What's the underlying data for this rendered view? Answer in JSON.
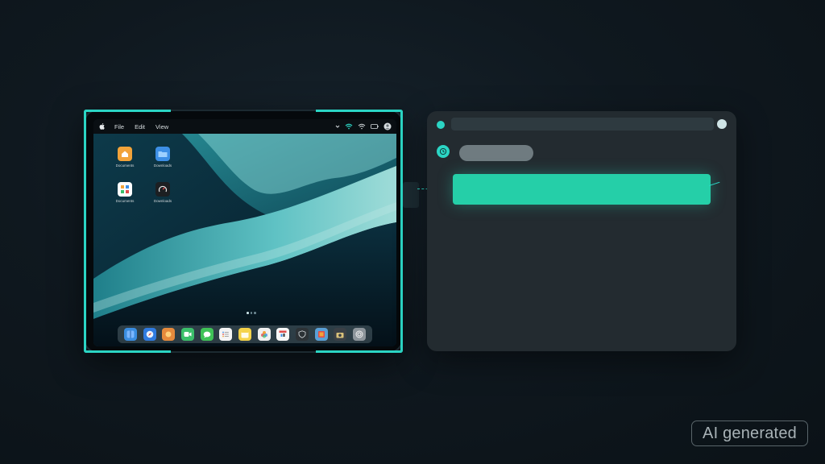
{
  "menubar": {
    "items": [
      "File",
      "Edit",
      "View"
    ]
  },
  "desktop": {
    "icons": [
      {
        "label": "Documents",
        "icon": "home-icon",
        "color": "#f2a33a"
      },
      {
        "label": "Downloads",
        "icon": "folder-icon",
        "color": "#3d8fe6"
      },
      {
        "label": "Documents",
        "icon": "grid-apps-icon",
        "color": "#ffffff"
      },
      {
        "label": "Downloads",
        "icon": "dial-icon",
        "color": "#1c1f22"
      }
    ]
  },
  "dock": {
    "apps": [
      {
        "name": "finder-icon",
        "color": "#3a8de0"
      },
      {
        "name": "safari-icon",
        "color": "#2f7be0"
      },
      {
        "name": "photos-app-icon",
        "color": "#e68a3c"
      },
      {
        "name": "facetime-icon",
        "color": "#3bbf6a"
      },
      {
        "name": "messages-icon",
        "color": "#3fc257"
      },
      {
        "name": "reminders-icon",
        "color": "#f4f4f4"
      },
      {
        "name": "notes-icon",
        "color": "#f5d34a"
      },
      {
        "name": "photos-icon",
        "color": "#f0f0f0"
      },
      {
        "name": "calendar-icon",
        "color": "#f7f7f7"
      },
      {
        "name": "security-icon",
        "color": "#2c3236"
      },
      {
        "name": "preview-icon",
        "color": "#5aa0d6"
      },
      {
        "name": "camera-icon",
        "color": "#3a4046"
      },
      {
        "name": "settings-icon",
        "color": "#8d959b"
      }
    ]
  },
  "colors": {
    "accent": "#2bd5c4",
    "highlight": "#25cfa8"
  },
  "badge": {
    "text": "AI generated"
  }
}
